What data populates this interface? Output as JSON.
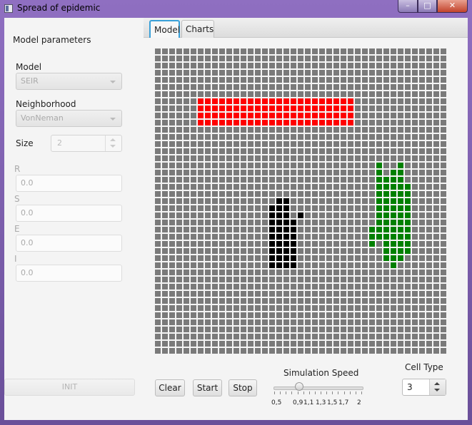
{
  "window": {
    "title": "Spread of epidemic",
    "min_glyph": "–",
    "max_glyph": "□",
    "close_glyph": "✕"
  },
  "left": {
    "heading": "Model parameters",
    "model": {
      "label": "Model",
      "value": "SEIR"
    },
    "neighborhood": {
      "label": "Neighborhood",
      "value": "VonNeman"
    },
    "size": {
      "label": "Size",
      "value": "2"
    },
    "params": [
      {
        "label": "R",
        "value": "0.0"
      },
      {
        "label": "S",
        "value": "0.0"
      },
      {
        "label": "E",
        "value": "0.0"
      },
      {
        "label": "I",
        "value": "0.0"
      }
    ],
    "init_label": "INIT"
  },
  "tabs": [
    {
      "label": "Model"
    },
    {
      "label": "Charts"
    }
  ],
  "grid": {
    "cols": 41,
    "rows": 43,
    "colors": {
      "empty": "#7a7a7a",
      "red": "#ff0000",
      "black": "#000000",
      "green": "#008000"
    },
    "red_block": {
      "rows": [
        7,
        10
      ],
      "cols": [
        6,
        27
      ]
    },
    "black_cells": [
      [
        21,
        17
      ],
      [
        21,
        18
      ],
      [
        22,
        16
      ],
      [
        22,
        17
      ],
      [
        22,
        18
      ],
      [
        23,
        16
      ],
      [
        23,
        17
      ],
      [
        23,
        18
      ],
      [
        23,
        20
      ],
      [
        24,
        16
      ],
      [
        24,
        17
      ],
      [
        24,
        18
      ],
      [
        24,
        19
      ],
      [
        25,
        16
      ],
      [
        25,
        17
      ],
      [
        25,
        18
      ],
      [
        25,
        19
      ],
      [
        26,
        16
      ],
      [
        26,
        17
      ],
      [
        26,
        18
      ],
      [
        26,
        19
      ],
      [
        27,
        16
      ],
      [
        27,
        17
      ],
      [
        27,
        18
      ],
      [
        27,
        19
      ],
      [
        28,
        16
      ],
      [
        28,
        17
      ],
      [
        28,
        18
      ],
      [
        28,
        19
      ],
      [
        29,
        16
      ],
      [
        29,
        17
      ],
      [
        29,
        18
      ],
      [
        29,
        19
      ],
      [
        30,
        16
      ],
      [
        30,
        17
      ],
      [
        30,
        18
      ],
      [
        30,
        19
      ]
    ],
    "green_cells": [
      [
        16,
        31
      ],
      [
        16,
        34
      ],
      [
        17,
        31
      ],
      [
        17,
        33
      ],
      [
        17,
        34
      ],
      [
        18,
        31
      ],
      [
        18,
        32
      ],
      [
        18,
        33
      ],
      [
        18,
        34
      ],
      [
        19,
        31
      ],
      [
        19,
        32
      ],
      [
        19,
        33
      ],
      [
        19,
        34
      ],
      [
        19,
        35
      ],
      [
        20,
        31
      ],
      [
        20,
        32
      ],
      [
        20,
        33
      ],
      [
        20,
        34
      ],
      [
        20,
        35
      ],
      [
        21,
        31
      ],
      [
        21,
        32
      ],
      [
        21,
        33
      ],
      [
        21,
        34
      ],
      [
        21,
        35
      ],
      [
        22,
        31
      ],
      [
        22,
        32
      ],
      [
        22,
        33
      ],
      [
        22,
        34
      ],
      [
        22,
        35
      ],
      [
        23,
        31
      ],
      [
        23,
        32
      ],
      [
        23,
        33
      ],
      [
        23,
        34
      ],
      [
        23,
        35
      ],
      [
        24,
        31
      ],
      [
        24,
        32
      ],
      [
        24,
        33
      ],
      [
        24,
        34
      ],
      [
        24,
        35
      ],
      [
        25,
        30
      ],
      [
        25,
        31
      ],
      [
        25,
        32
      ],
      [
        25,
        33
      ],
      [
        25,
        34
      ],
      [
        25,
        35
      ],
      [
        26,
        30
      ],
      [
        26,
        31
      ],
      [
        26,
        32
      ],
      [
        26,
        33
      ],
      [
        26,
        34
      ],
      [
        26,
        35
      ],
      [
        27,
        30
      ],
      [
        27,
        32
      ],
      [
        27,
        33
      ],
      [
        27,
        34
      ],
      [
        27,
        35
      ],
      [
        28,
        32
      ],
      [
        28,
        33
      ],
      [
        28,
        34
      ],
      [
        28,
        35
      ],
      [
        29,
        32
      ],
      [
        29,
        33
      ],
      [
        29,
        34
      ],
      [
        30,
        33
      ]
    ]
  },
  "controls": {
    "clear_label": "Clear",
    "start_label": "Start",
    "stop_label": "Stop",
    "speed": {
      "label": "Simulation Speed",
      "value": 0.9,
      "min": 0.5,
      "max": 2,
      "tick_labels": [
        "0,5",
        "0,9",
        "1,1",
        "1,3",
        "1,5",
        "1,7",
        "2"
      ]
    },
    "cell_type": {
      "label": "Cell Type",
      "value": "3"
    }
  }
}
